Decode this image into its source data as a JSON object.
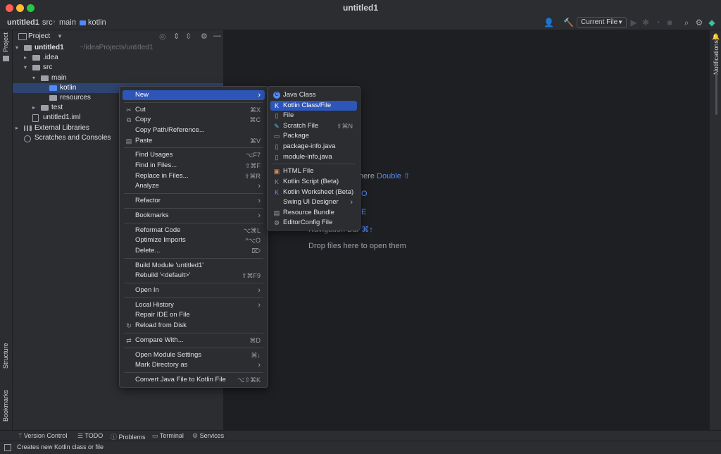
{
  "window": {
    "title": "untitled1"
  },
  "breadcrumb": [
    "untitled1",
    "src",
    "main",
    "kotlin"
  ],
  "toolbar": {
    "run_config": "Current File"
  },
  "left_strip": {
    "project": "Project",
    "structure": "Structure",
    "bookmarks": "Bookmarks"
  },
  "right_strip": {
    "notifications": "Notifications"
  },
  "project_panel": {
    "title": "Project",
    "tree": [
      {
        "label": "untitled1",
        "suffix": "~/IdeaProjects/untitled1",
        "depth": 0,
        "expanded": true,
        "kind": "module"
      },
      {
        "label": ".idea",
        "depth": 1,
        "expanded": false,
        "kind": "folder"
      },
      {
        "label": "src",
        "depth": 1,
        "expanded": true,
        "kind": "folder"
      },
      {
        "label": "main",
        "depth": 2,
        "expanded": true,
        "kind": "folder"
      },
      {
        "label": "kotlin",
        "depth": 3,
        "kind": "source-folder",
        "selected": true
      },
      {
        "label": "resources",
        "depth": 3,
        "kind": "resource-folder"
      },
      {
        "label": "test",
        "depth": 2,
        "expanded": false,
        "kind": "folder"
      },
      {
        "label": "untitled1.iml",
        "depth": 1,
        "kind": "file"
      },
      {
        "label": "External Libraries",
        "depth": 0,
        "expanded": false,
        "kind": "library"
      },
      {
        "label": "Scratches and Consoles",
        "depth": 0,
        "kind": "scratch"
      }
    ]
  },
  "editor": {
    "hints": [
      {
        "text": "where",
        "key": "Double ⇧"
      },
      {
        "text": "",
        "key": "⌘O"
      },
      {
        "text": "",
        "key": "⌘E"
      },
      {
        "text": "Navigation Bar",
        "key": "⌘↑"
      },
      {
        "text": "Drop files here to open them",
        "key": ""
      }
    ]
  },
  "context_menu": {
    "groups": [
      [
        {
          "label": "New",
          "submenu": true,
          "selected": true
        }
      ],
      [
        {
          "label": "Cut",
          "shortcut": "⌘X",
          "icon": "cut-icon"
        },
        {
          "label": "Copy",
          "shortcut": "⌘C",
          "icon": "copy-icon"
        },
        {
          "label": "Copy Path/Reference..."
        },
        {
          "label": "Paste",
          "shortcut": "⌘V",
          "icon": "paste-icon"
        }
      ],
      [
        {
          "label": "Find Usages",
          "shortcut": "⌥F7"
        },
        {
          "label": "Find in Files...",
          "shortcut": "⇧⌘F"
        },
        {
          "label": "Replace in Files...",
          "shortcut": "⇧⌘R"
        },
        {
          "label": "Analyze",
          "submenu": true
        }
      ],
      [
        {
          "label": "Refactor",
          "submenu": true
        }
      ],
      [
        {
          "label": "Bookmarks",
          "submenu": true
        }
      ],
      [
        {
          "label": "Reformat Code",
          "shortcut": "⌥⌘L"
        },
        {
          "label": "Optimize Imports",
          "shortcut": "^⌥O"
        },
        {
          "label": "Delete...",
          "shortcut": "⌦"
        }
      ],
      [
        {
          "label": "Build Module 'untitled1'"
        },
        {
          "label": "Rebuild '<default>'",
          "shortcut": "⇧⌘F9"
        }
      ],
      [
        {
          "label": "Open In",
          "submenu": true
        }
      ],
      [
        {
          "label": "Local History",
          "submenu": true
        },
        {
          "label": "Repair IDE on File"
        },
        {
          "label": "Reload from Disk",
          "icon": "reload-icon"
        }
      ],
      [
        {
          "label": "Compare With...",
          "shortcut": "⌘D",
          "icon": "compare-icon"
        }
      ],
      [
        {
          "label": "Open Module Settings",
          "shortcut": "⌘↓"
        },
        {
          "label": "Mark Directory as",
          "submenu": true
        }
      ],
      [
        {
          "label": "Convert Java File to Kotlin File",
          "shortcut": "⌥⇧⌘K"
        }
      ]
    ]
  },
  "new_submenu": {
    "groups": [
      [
        {
          "label": "Java Class",
          "icon": "java-class-icon",
          "color": "#548af7"
        },
        {
          "label": "Kotlin Class/File",
          "icon": "kotlin-icon",
          "color": "#a974e8",
          "selected": true
        },
        {
          "label": "File",
          "icon": "file-icon",
          "color": "#9da0a8"
        },
        {
          "label": "Scratch File",
          "shortcut": "⇧⌘N",
          "icon": "scratch-file-icon",
          "color": "#5fb8f4"
        },
        {
          "label": "Package",
          "icon": "package-icon",
          "color": "#9da0a8"
        },
        {
          "label": "package-info.java",
          "icon": "java-file-icon",
          "color": "#9da0a8"
        },
        {
          "label": "module-info.java",
          "icon": "java-file-icon",
          "color": "#9da0a8"
        }
      ],
      [
        {
          "label": "HTML File",
          "icon": "html-icon",
          "color": "#e08855"
        },
        {
          "label": "Kotlin Script (Beta)",
          "icon": "kotlin-script-icon",
          "color": "#a974e8"
        },
        {
          "label": "Kotlin Worksheet (Beta)",
          "icon": "kotlin-worksheet-icon",
          "color": "#a974e8"
        },
        {
          "label": "Swing UI Designer",
          "submenu": true
        },
        {
          "label": "Resource Bundle",
          "icon": "resource-bundle-icon",
          "color": "#9da0a8"
        },
        {
          "label": "EditorConfig File",
          "icon": "gear-icon",
          "color": "#9da0a8"
        }
      ]
    ]
  },
  "bottom_tabs": [
    "Version Control",
    "TODO",
    "Problems",
    "Terminal",
    "Services"
  ],
  "status": {
    "text": "Creates new Kotlin class or file"
  },
  "colors": {
    "accent": "#2e55b8",
    "selection": "#2e436e",
    "background": "#1e1f22",
    "panel": "#2b2d30"
  }
}
